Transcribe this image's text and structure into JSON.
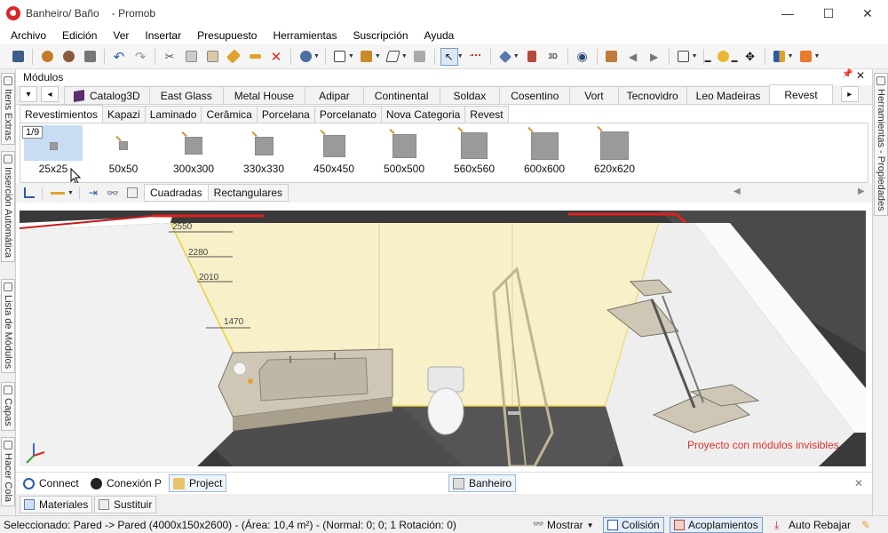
{
  "window": {
    "title": "Banheiro/ Baño",
    "app_name": "- Promob",
    "minimize_icon": "—",
    "maximize_icon": "☐",
    "close_icon": "✕"
  },
  "menu": [
    "Archivo",
    "Edición",
    "Ver",
    "Insertar",
    "Presupuesto",
    "Herramientas",
    "Suscripción",
    "Ayuda"
  ],
  "left_dock": {
    "tabs": [
      "Itens Extras",
      "Inserción Automática",
      "Lista de Módulos",
      "Capas",
      "Hacer Cola"
    ]
  },
  "right_dock": {
    "tabs": [
      "Herramientas - Propiedades"
    ]
  },
  "modulos": {
    "title": "Módulos",
    "pin_icon": "📌",
    "close_icon": "✕",
    "nav_down": "▾",
    "nav_left": "◂",
    "nav_right": "▸",
    "categories": [
      "Catalog3D",
      "East Glass",
      "Metal House",
      "Adipar",
      "Continental",
      "Soldax",
      "Cosentino",
      "Vort",
      "Tecnovidro",
      "Leo Madeiras",
      "Revest"
    ],
    "active_category": "Revest",
    "subcategories": [
      "Revestimientos",
      "Kapazi",
      "Laminado",
      "Cerâmica",
      "Porcelana",
      "Porcelanato",
      "Nova Categoria",
      "Revest"
    ],
    "active_subcategory": "Revestimientos",
    "page_indicator": "1/9",
    "tiles": [
      {
        "label": "25x25",
        "size": 25
      },
      {
        "label": "50x50",
        "size": 50
      },
      {
        "label": "300x300",
        "size": 300
      },
      {
        "label": "330x330",
        "size": 330
      },
      {
        "label": "450x450",
        "size": 450
      },
      {
        "label": "500x500",
        "size": 500
      },
      {
        "label": "560x560",
        "size": 560
      },
      {
        "label": "600x600",
        "size": 600
      },
      {
        "label": "620x620",
        "size": 620
      }
    ],
    "selected_tile": "25x25",
    "filter_tabs": [
      "Cuadradas",
      "Rectangulares"
    ],
    "active_filter": "Cuadradas"
  },
  "viewport": {
    "wall_marks": [
      "2550",
      "2280",
      "2010",
      "1470"
    ],
    "invisible_modules_note": "Proyecto con módulos invisibles"
  },
  "bottom_tabs": [
    "Connect",
    "Conexión P",
    "Project"
  ],
  "document_tab": "Banheiro",
  "lower_tabs": [
    "Materiales",
    "Sustituir"
  ],
  "status": {
    "selection": "Seleccionado: Pared -> Pared (4000x150x2600) - (Área: 10,4 m²) - (Normal: 0; 0; 1 Rotación: 0)",
    "show": "Mostrar",
    "collision": "Colisión",
    "couplings": "Acoplamientos",
    "auto_lower": "Auto Rebajar"
  },
  "colors": {
    "accent_red": "#d8262a",
    "selection_blue": "#c9dcf4",
    "wall_yellow": "#f7f0c8",
    "note_red": "#e2322c"
  }
}
